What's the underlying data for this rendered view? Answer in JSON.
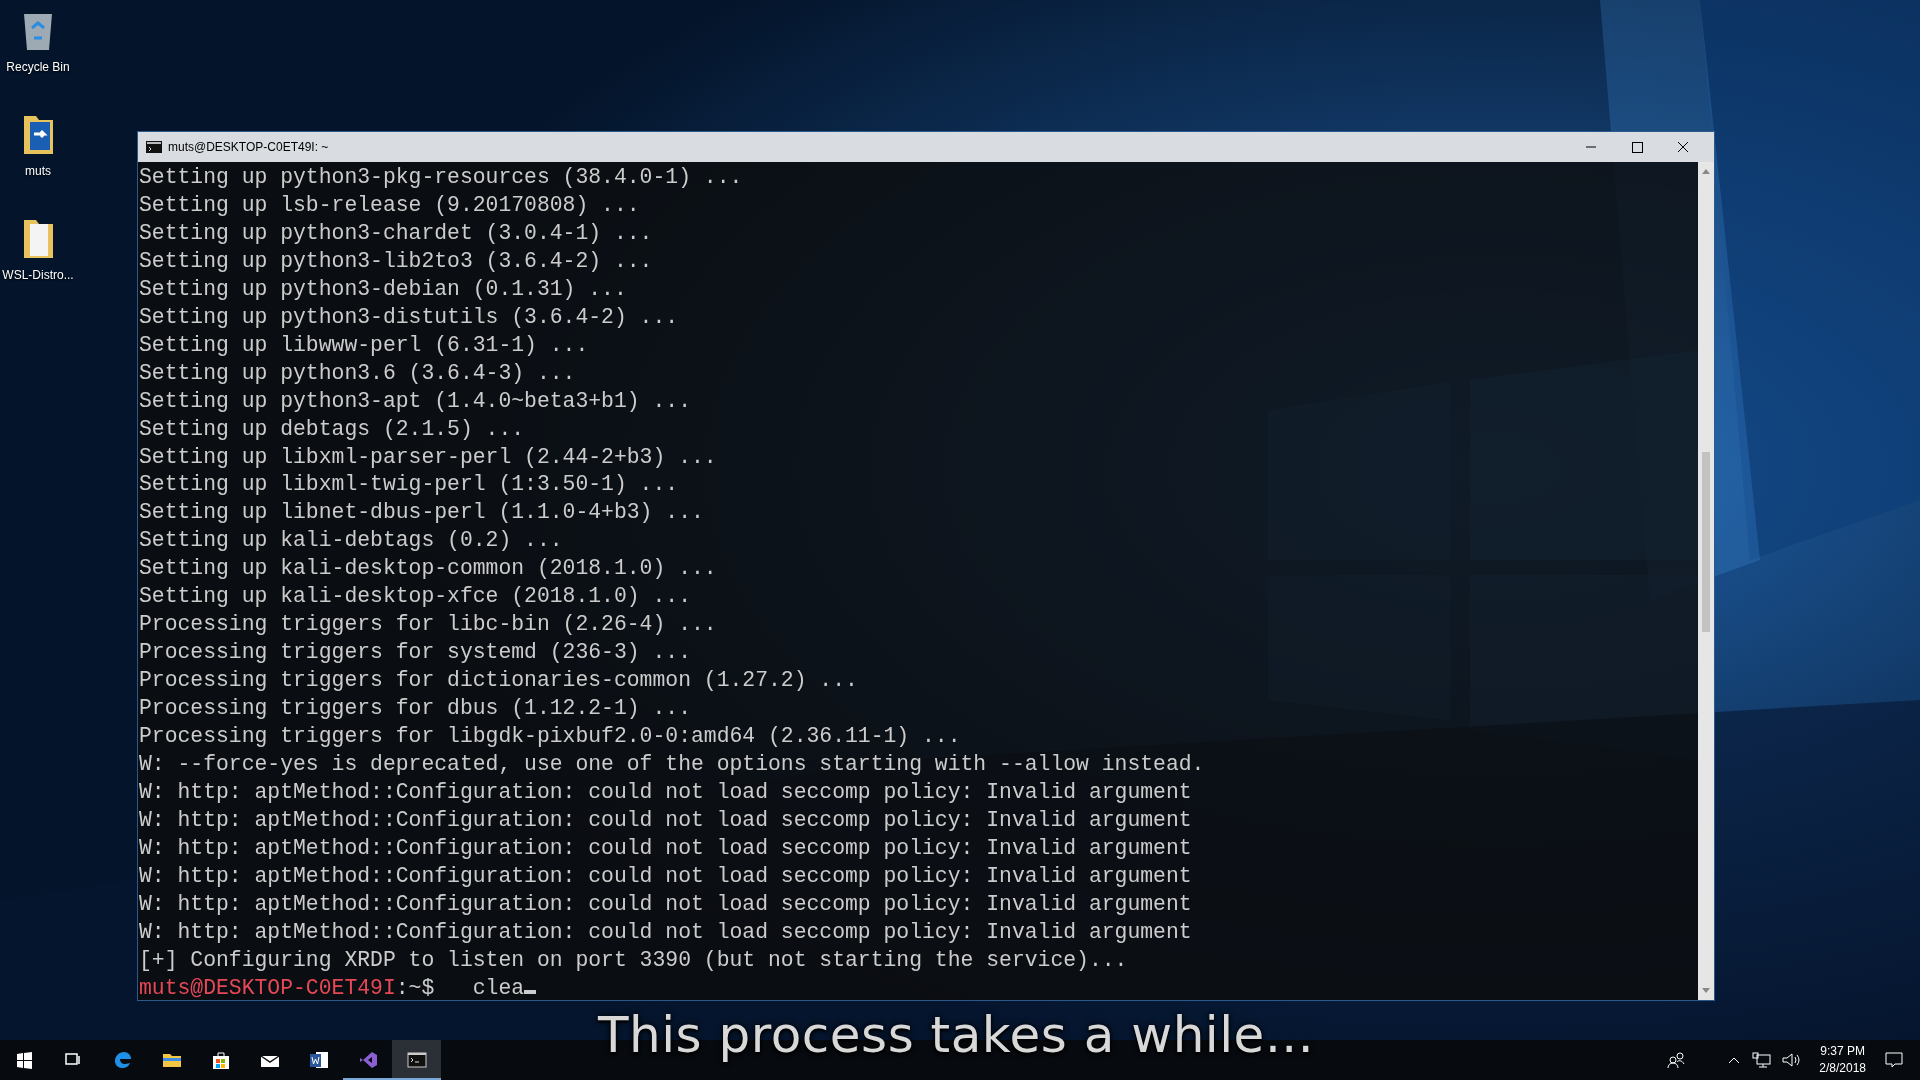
{
  "desktop_icons": [
    {
      "kind": "recycle",
      "label": "Recycle Bin"
    },
    {
      "kind": "teamfolder",
      "label": "muts"
    },
    {
      "kind": "folder",
      "label": "WSL-Distro..."
    }
  ],
  "window": {
    "title": "muts@DESKTOP-C0ET49I: ~",
    "lines": [
      "Setting up python3-pkg-resources (38.4.0-1) ...",
      "Setting up lsb-release (9.20170808) ...",
      "Setting up python3-chardet (3.0.4-1) ...",
      "Setting up python3-lib2to3 (3.6.4-2) ...",
      "Setting up python3-debian (0.1.31) ...",
      "Setting up python3-distutils (3.6.4-2) ...",
      "Setting up libwww-perl (6.31-1) ...",
      "Setting up python3.6 (3.6.4-3) ...",
      "Setting up python3-apt (1.4.0~beta3+b1) ...",
      "Setting up debtags (2.1.5) ...",
      "Setting up libxml-parser-perl (2.44-2+b3) ...",
      "Setting up libxml-twig-perl (1:3.50-1) ...",
      "Setting up libnet-dbus-perl (1.1.0-4+b3) ...",
      "Setting up kali-debtags (0.2) ...",
      "Setting up kali-desktop-common (2018.1.0) ...",
      "Setting up kali-desktop-xfce (2018.1.0) ...",
      "Processing triggers for libc-bin (2.26-4) ...",
      "Processing triggers for systemd (236-3) ...",
      "Processing triggers for dictionaries-common (1.27.2) ...",
      "Processing triggers for dbus (1.12.2-1) ...",
      "Processing triggers for libgdk-pixbuf2.0-0:amd64 (2.36.11-1) ...",
      "W: --force-yes is deprecated, use one of the options starting with --allow instead.",
      "W: http: aptMethod::Configuration: could not load seccomp policy: Invalid argument",
      "W: http: aptMethod::Configuration: could not load seccomp policy: Invalid argument",
      "W: http: aptMethod::Configuration: could not load seccomp policy: Invalid argument",
      "W: http: aptMethod::Configuration: could not load seccomp policy: Invalid argument",
      "W: http: aptMethod::Configuration: could not load seccomp policy: Invalid argument",
      "W: http: aptMethod::Configuration: could not load seccomp policy: Invalid argument",
      "[+] Configuring XRDP to listen on port 3390 (but not starting the service)..."
    ],
    "prompt": {
      "user_host": "muts@DESKTOP-C0ET49I",
      "path": ":~$",
      "input": "clea"
    }
  },
  "caption": "This process takes a while...",
  "taskbar": {
    "apps": [
      {
        "kind": "start",
        "running": false,
        "selected": false
      },
      {
        "kind": "taskview",
        "running": false,
        "selected": false
      },
      {
        "kind": "edge",
        "running": false,
        "selected": false
      },
      {
        "kind": "explorer",
        "running": false,
        "selected": false
      },
      {
        "kind": "store",
        "running": false,
        "selected": false
      },
      {
        "kind": "mail",
        "running": false,
        "selected": false
      },
      {
        "kind": "word",
        "running": false,
        "selected": false
      },
      {
        "kind": "vs",
        "running": true,
        "selected": false
      },
      {
        "kind": "terminal",
        "running": true,
        "selected": true
      }
    ],
    "time": "9:37 PM",
    "date": "2/8/2018"
  }
}
